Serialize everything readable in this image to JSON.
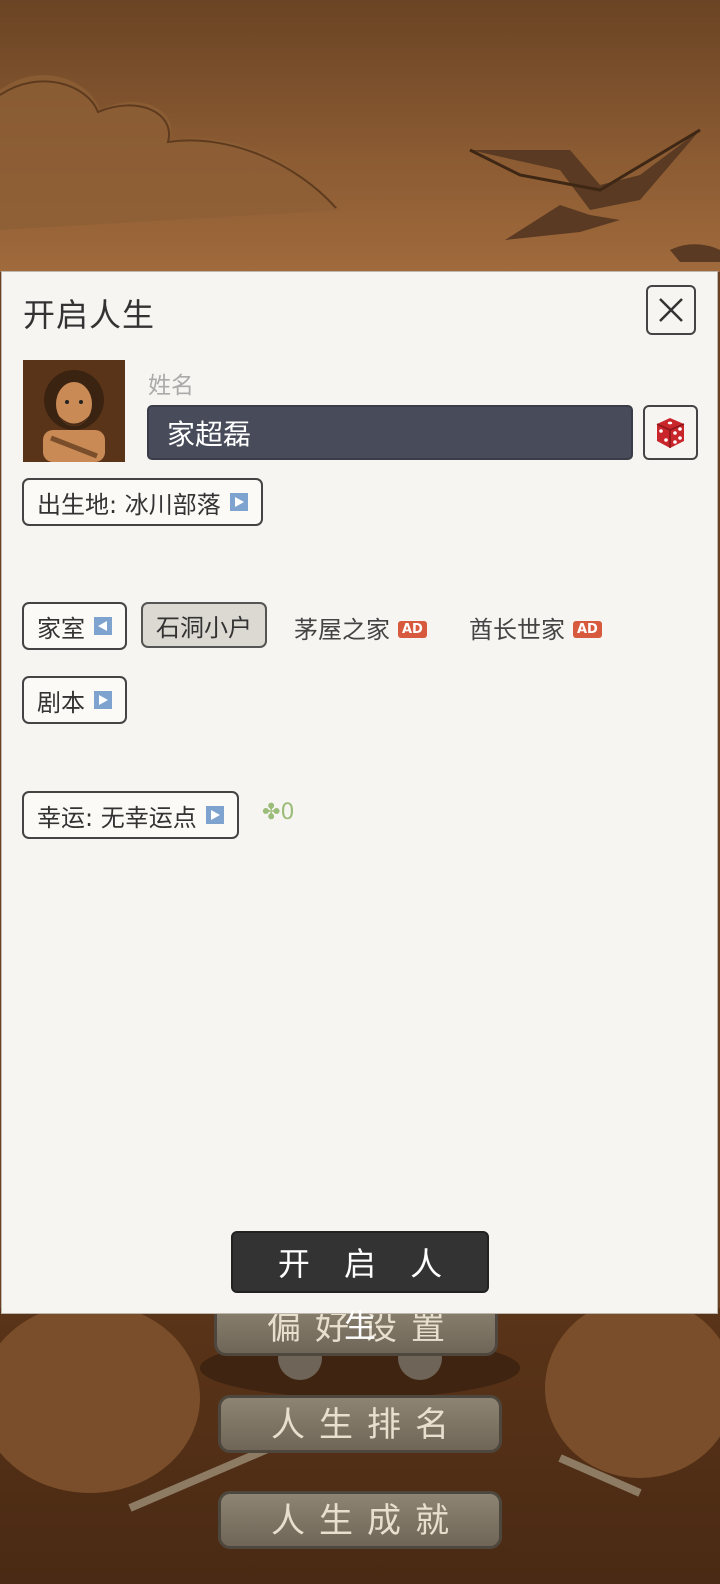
{
  "dialog": {
    "title": "开启人生",
    "name_label": "姓名",
    "name_value": "家超磊",
    "birthplace_label": "出生地: 冰川部落",
    "family": {
      "label": "家室",
      "options": [
        {
          "label": "石洞小户",
          "selected": true,
          "ad": false
        },
        {
          "label": "茅屋之家",
          "selected": false,
          "ad": true
        },
        {
          "label": "酋长世家",
          "selected": false,
          "ad": true
        }
      ],
      "ad_badge": "AD"
    },
    "script_label": "剧本",
    "luck_label": "幸运: 无幸运点",
    "luck_points": "0",
    "start_button": "开 启 人 生"
  },
  "menu": {
    "preferences": "偏好设置",
    "ranking": "人生排名",
    "achievements": "人生成就"
  },
  "icons": {
    "close": "close-icon",
    "dice": "dice-icon",
    "arrow_right": "play-right-icon",
    "arrow_left": "play-left-icon",
    "clover": "clover-icon"
  },
  "colors": {
    "input_bg": "#484b5a",
    "arrow_accent": "#7fa3cf",
    "ad_badge": "#d85a3e",
    "clover": "#9cbc7a",
    "dice_red": "#c9262c"
  }
}
